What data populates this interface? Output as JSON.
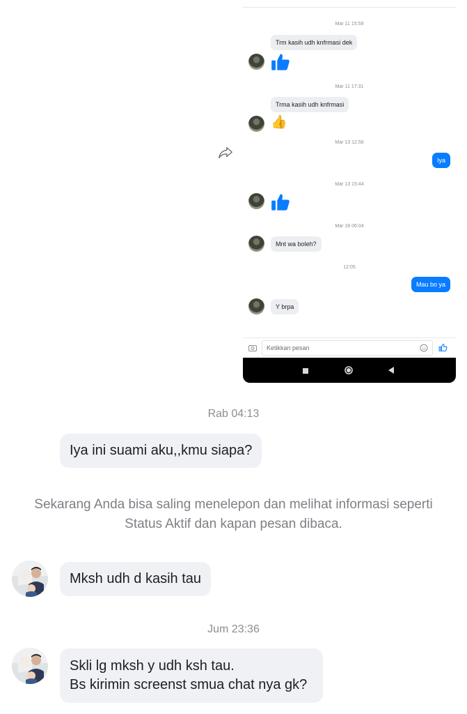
{
  "forwarded_screenshot": {
    "messages": [
      {
        "type": "timestamp",
        "text": "Mar 11 15:59"
      },
      {
        "type": "incoming",
        "text": "Trm kasih udh knfrmasi dek"
      },
      {
        "type": "like",
        "icon": "blue-thumbs-up-icon"
      },
      {
        "type": "timestamp",
        "text": "Mar 11 17:31"
      },
      {
        "type": "incoming",
        "text": "Trma kasih udh knfrmasi"
      },
      {
        "type": "emoji",
        "icon": "thumbs-up-emoji",
        "text": "👍"
      },
      {
        "type": "timestamp",
        "text": "Mar 13 12:56"
      },
      {
        "type": "outgoing",
        "text": "Iya"
      },
      {
        "type": "timestamp",
        "text": "Mar 13 15:44"
      },
      {
        "type": "like",
        "icon": "blue-thumbs-up-icon"
      },
      {
        "type": "timestamp",
        "text": "Mar 18 06:04"
      },
      {
        "type": "incoming",
        "text": "Mnt wa boleh?"
      },
      {
        "type": "timestamp",
        "text": "12:05"
      },
      {
        "type": "outgoing",
        "text": "Mau bo ya"
      },
      {
        "type": "incoming",
        "text": "Y brpa"
      }
    ],
    "composer": {
      "placeholder": "Ketikkan pesan"
    },
    "colors": {
      "outgoing": "#0a7cff",
      "incoming": "#eceef1",
      "like": "#0a7cff"
    }
  },
  "main_chat": {
    "ts1": "Rab 04:13",
    "msg_out": "Iya ini suami aku,,kmu siapa?",
    "info_line1": "Sekarang Anda bisa saling menelepon dan melihat informasi seperti",
    "info_line2": "Status Aktif dan kapan pesan dibaca.",
    "msg_in1": "Mksh udh d kasih tau",
    "ts2": "Jum 23:36",
    "msg_in2_line1": "Skli lg mksh y udh ksh tau.",
    "msg_in2_line2": "Bs kirimin screenst smua chat nya gk?"
  }
}
